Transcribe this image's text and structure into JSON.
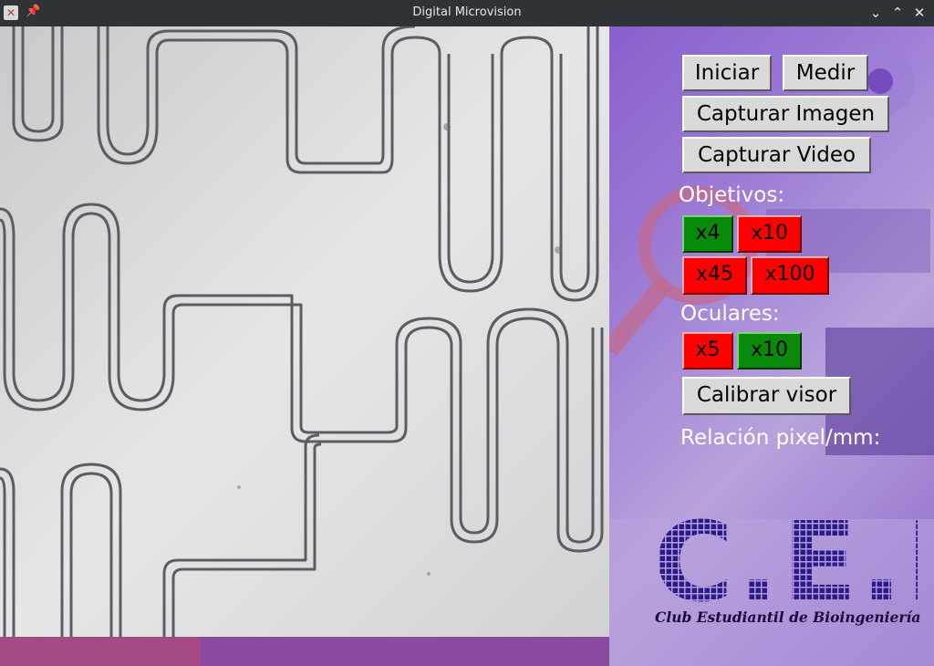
{
  "window": {
    "title": "Digital Microvision",
    "controls": [
      "minimize",
      "maximize",
      "close"
    ]
  },
  "toolbar": {
    "start_label": "Iniciar",
    "measure_label": "Medir",
    "capture_image_label": "Capturar Imagen",
    "capture_video_label": "Capturar Video"
  },
  "objectives": {
    "title": "Objetivos:",
    "options": [
      {
        "label": "x4",
        "selected": true
      },
      {
        "label": "x10",
        "selected": false
      },
      {
        "label": "x45",
        "selected": false
      },
      {
        "label": "x100",
        "selected": false
      }
    ]
  },
  "eyepieces": {
    "title": "Oculares:",
    "options": [
      {
        "label": "x5",
        "selected": false
      },
      {
        "label": "x10",
        "selected": true
      }
    ]
  },
  "calibrate_label": "Calibrar visor",
  "ratio_label": "Relación pixel/mm:",
  "logo": {
    "text": "C.E.B.",
    "subtitle": "Club Estudiantil de Bioingeniería"
  },
  "colors": {
    "selected": "#0a8a0a",
    "unselected": "#ff0000",
    "panel_bg": "#7e52c8",
    "titlebar": "#2f3338"
  }
}
